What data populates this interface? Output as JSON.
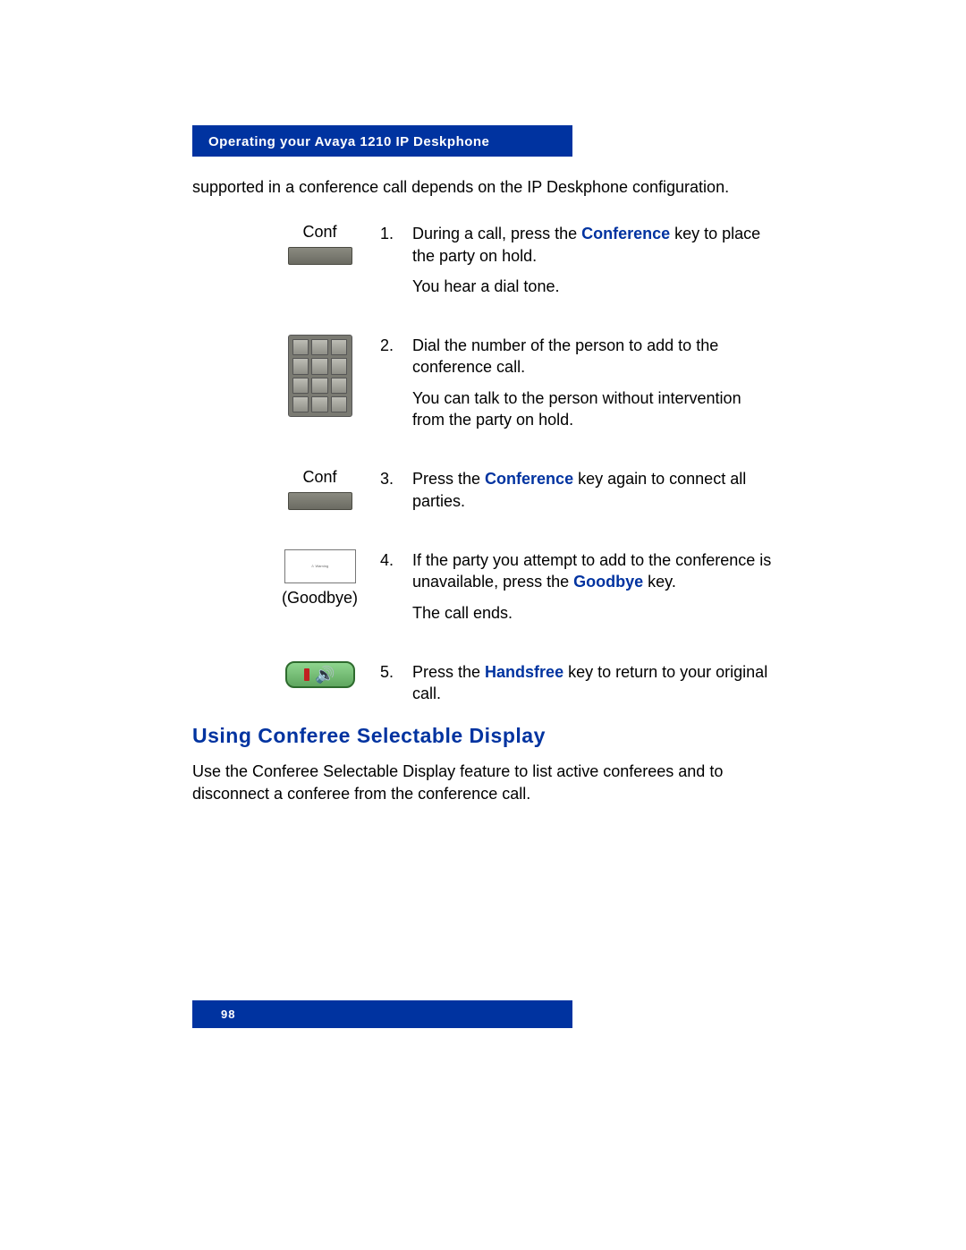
{
  "header": {
    "title": "Operating your Avaya 1210 IP Deskphone"
  },
  "intro": "supported in a conference call depends on the IP Deskphone configuration.",
  "steps": [
    {
      "icon": "softkey",
      "label": "Conf",
      "num": "1.",
      "line1_pre": "During a call, press the ",
      "line1_key": "Conference",
      "line1_post": " key to place the party on hold.",
      "line2": "You hear a dial tone."
    },
    {
      "icon": "keypad",
      "label": "",
      "num": "2.",
      "line1_pre": "Dial the number of the person to add to the conference call.",
      "line1_key": "",
      "line1_post": "",
      "line2": "You can talk to the person without intervention from the party on hold."
    },
    {
      "icon": "softkey",
      "label": "Conf",
      "num": "3.",
      "line1_pre": "Press the ",
      "line1_key": "Conference",
      "line1_post": " key again to connect all parties.",
      "line2": ""
    },
    {
      "icon": "warning",
      "label": "(Goodbye)",
      "num": "4.",
      "line1_pre": "If the party you attempt to add to the conference is unavailable, press the ",
      "line1_key": "Goodbye",
      "line1_post": " key.",
      "line2": "The call ends."
    },
    {
      "icon": "handsfree",
      "label": "",
      "num": "5.",
      "line1_pre": "Press the ",
      "line1_key": "Handsfree",
      "line1_post": " key to return to your original call.",
      "line2": ""
    }
  ],
  "section": {
    "heading": "Using Conferee Selectable Display",
    "body": "Use the Conferee Selectable Display feature to list active conferees and to disconnect a conferee from the conference call."
  },
  "footer": {
    "page_number": "98"
  }
}
